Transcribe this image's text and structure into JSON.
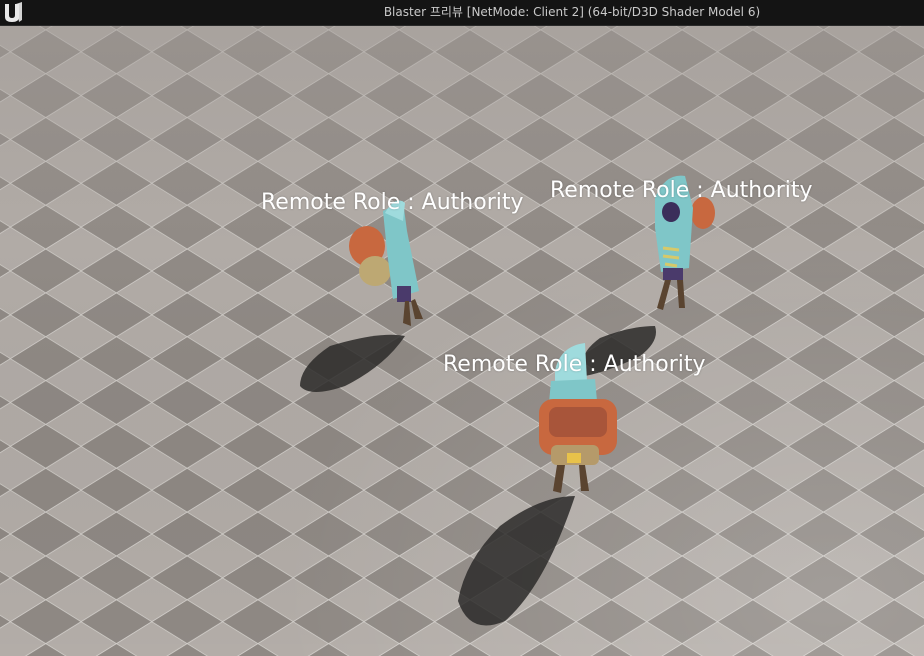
{
  "window": {
    "title": "Blaster 프리뷰 [NetMode: Client 2]  (64-bit/D3D Shader Model 6)",
    "logo_icon": "unreal-engine-logo-icon"
  },
  "viewport": {
    "overhead_labels": [
      "Remote Role : Authority",
      "Remote Role : Authority",
      "Remote Role : Authority"
    ],
    "colors": {
      "floor_light": "#b3ada8",
      "floor_dark": "#8c8682",
      "grid_line": "#e8e6e4",
      "hood": "#7fc6c8",
      "backpack": "#c8683f"
    }
  }
}
